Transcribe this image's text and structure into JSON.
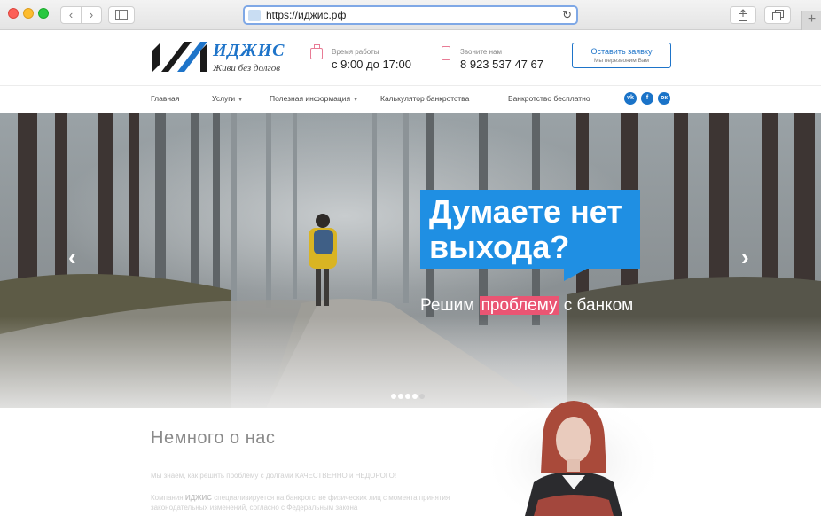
{
  "browser": {
    "url": "https://иджис.рф",
    "back_icon": "chevron-left-icon",
    "forward_icon": "chevron-right-icon",
    "sidebar_icon": "sidebar-icon",
    "reload_icon": "reload-icon",
    "share_icon": "share-icon",
    "tabs_icon": "tabs-icon",
    "new_tab_label": "+"
  },
  "header": {
    "logo_name": "ИДЖИС",
    "logo_tagline": "Живи без долгов",
    "hours_label": "Время работы",
    "hours_value": "с 9:00 до 17:00",
    "phone_label": "Звоните нам",
    "phone_value": "8 923 537 47 67",
    "cta_title": "Оставить заявку",
    "cta_subtitle": "Мы перезвоним Вам",
    "accent_color": "#1e74c9",
    "icon_color": "#e87b95"
  },
  "nav": {
    "items": [
      {
        "label": "Главная"
      },
      {
        "label": "Услуги",
        "has_dropdown": true
      },
      {
        "label": "Полезная информация",
        "has_dropdown": true
      },
      {
        "label": "Калькулятор банкротства"
      },
      {
        "label": "Банкротство бесплатно"
      }
    ],
    "social": [
      {
        "icon": "vk-icon",
        "label": "vk"
      },
      {
        "icon": "facebook-icon",
        "label": "f"
      },
      {
        "icon": "odnoklassniki-icon",
        "label": "ок"
      }
    ]
  },
  "hero": {
    "headline": "Думаете нет выхода?",
    "subtitle_before": "Решим ",
    "subtitle_highlight": "проблему",
    "subtitle_after": " с банком",
    "prev_arrow": "‹",
    "next_arrow": "›",
    "slide_count": 5,
    "active_slide": 1,
    "bubble_color": "#1f8fe3",
    "highlight_color": "#ea5573"
  },
  "about": {
    "title": "Немного о нас",
    "paragraph1": "Мы знаем, как решить проблему с долгами КАЧЕСТВЕННО и НЕДОРОГО!",
    "paragraph2_prefix": "Компания ",
    "paragraph2_bold": "ИДЖИС",
    "paragraph2_rest": " специализируется на банкротстве физических лиц с момента принятия законодательных изменений, согласно с Федеральным закона"
  }
}
